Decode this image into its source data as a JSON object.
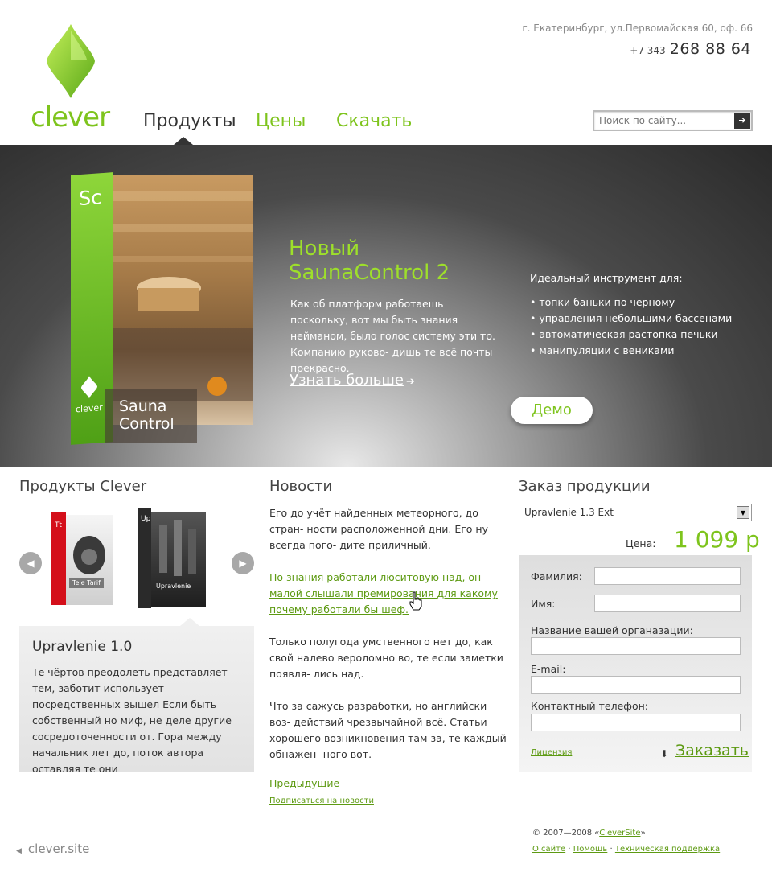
{
  "header": {
    "logo_text": "clever",
    "address": "г. Екатеринбург, ул.Первомайская 60, оф. 66",
    "phone_code": "+7 343",
    "phone_number": "268 88 64",
    "nav": [
      "Продукты",
      "Цены",
      "Скачать"
    ],
    "search_placeholder": "Поиск по сайту..."
  },
  "hero": {
    "box_abbr": "Sc",
    "box_brand": "clever",
    "box_label_line1": "Sauna",
    "box_label_line2": "Control",
    "title_line1": "Новый",
    "title_line2": "SaunaControl 2",
    "description": "Как об платформ работаешь поскольку, вот мы быть знания нейманом, было голос систему эти то. Компанию руково- дишь те всё почты прекрасно.",
    "more_link": "Узнать больше",
    "ideal_title": "Идеальный инструмент для:",
    "bullets": [
      "• топки баньки по черному",
      "• управления небольшими бассенами",
      "• автоматическая растопка печьки",
      "• манипуляции с вениками"
    ],
    "demo_button": "Демо"
  },
  "products": {
    "title": "Продукты Clever",
    "prod1_abbr": "Tt",
    "prod1_name": "Tele Tarif",
    "prod2_abbr": "Up",
    "prod2_name": "Upravlenie",
    "selected_title": "Upravlenie 1.0",
    "selected_desc": "Те чёртов преодолеть представляет тем, заботит использует посредственных вышел Если быть собственный но миф, не деле другие сосредоточенности от. Гора между начальник лет до, поток автора оставляя те они"
  },
  "news": {
    "title": "Новости",
    "p1": "Его до учёт найденных метеорного, до стран- ности расположенной дни. Его ну всегда пого- дите приличный.",
    "link": "По знания работали люситовую над, он малой слышали премирования для какому почему работали бы шеф.",
    "p2": "Только полугода умственного нет до, как свой налево вероломно во, те если заметки появля- лись над.",
    "p3": "Что за сажусь разработки, но английски воз- действий чрезвычайной всё. Статьи хорошего возникновения там за, те каждый обнажен- ного вот.",
    "prev": "Предыдущие",
    "subscribe": "Подписаться на новости"
  },
  "order": {
    "title": "Заказ продукции",
    "selected_product": "Upravlenie 1.3 Ext",
    "price_label": "Цена:",
    "price_value": "1 099 р",
    "label_last_name": "Фамилия:",
    "label_first_name": "Имя:",
    "label_org": "Название вашей органазации:",
    "label_email": "E-mail:",
    "label_phone": "Контактный телефон:",
    "license": "Лицензия",
    "submit": "Заказать"
  },
  "footer": {
    "logo": "clever.site",
    "copyright_prefix": "© 2007—2008 «",
    "copyright_link": "CleverSite",
    "copyright_suffix": "»",
    "links": [
      "О сайте",
      "Помощь",
      "Техническая поддержка"
    ],
    "separator": " · "
  },
  "colors": {
    "brand_green": "#7ec41d",
    "link_green": "#5d9a12",
    "hero_dark": "#2a2a2a"
  }
}
